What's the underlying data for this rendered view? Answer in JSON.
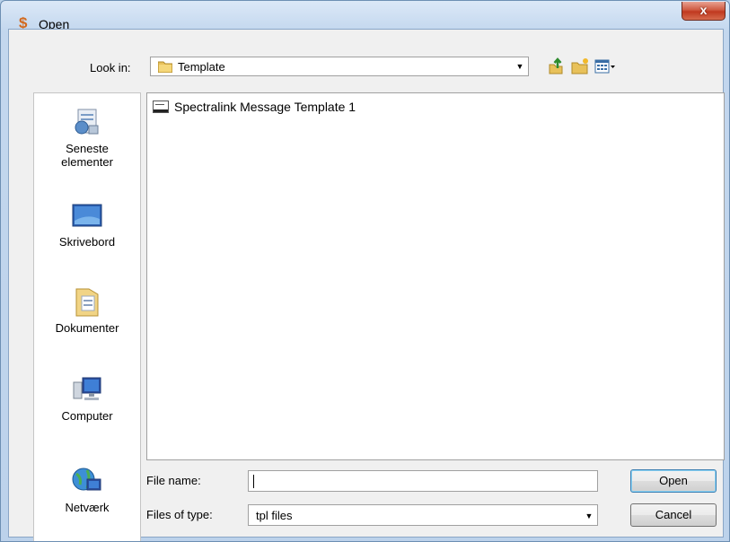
{
  "window": {
    "title": "Open",
    "close_glyph": "x"
  },
  "toolbar": {
    "look_in_label": "Look in:",
    "look_in_value": "Template",
    "icons": [
      "up-folder-icon",
      "new-folder-icon",
      "view-menu-icon"
    ]
  },
  "places": [
    {
      "name": "recent",
      "label": "Seneste elementer",
      "line1": "Seneste",
      "line2": "elementer",
      "icon": "recent-items-icon"
    },
    {
      "name": "desktop",
      "label": "Skrivebord",
      "icon": "desktop-icon"
    },
    {
      "name": "documents",
      "label": "Dokumenter",
      "icon": "documents-folder-icon"
    },
    {
      "name": "computer",
      "label": "Computer",
      "icon": "computer-icon"
    },
    {
      "name": "network",
      "label": "Netværk",
      "icon": "network-icon"
    }
  ],
  "files": [
    {
      "name": "Spectralink Message Template 1",
      "icon": "template-file-icon"
    }
  ],
  "form": {
    "file_name_label": "File name:",
    "file_name_value": "",
    "files_of_type_label": "Files of type:",
    "files_of_type_value": "tpl files"
  },
  "buttons": {
    "open": "Open",
    "cancel": "Cancel"
  },
  "colors": {
    "close_red": "#c0391f",
    "title_bar": "#c3d7ee",
    "client_bg": "#f0f0f0"
  }
}
